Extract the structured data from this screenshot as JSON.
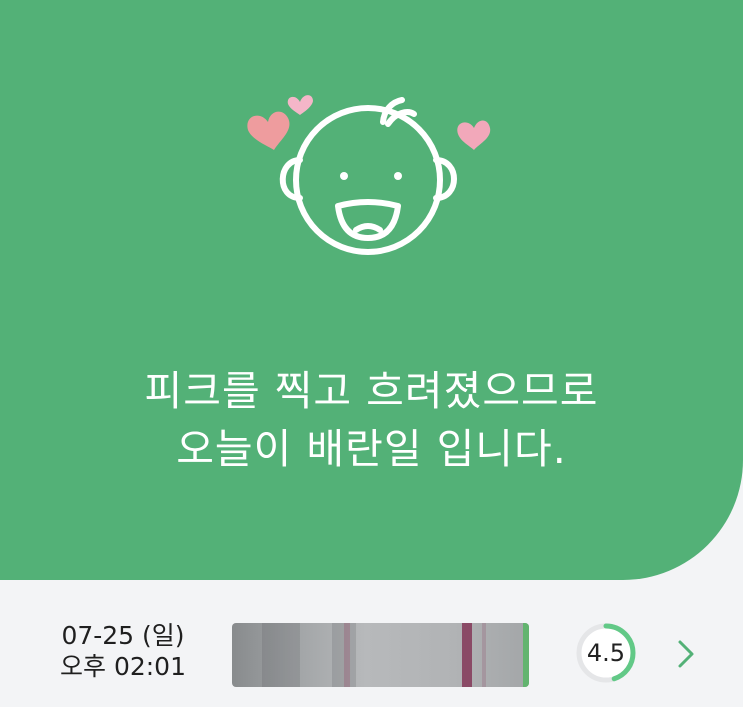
{
  "result": {
    "message_line1": "피크를 찍고 흐려졌으므로",
    "message_line2": "오늘이 배란일 입니다."
  },
  "record": {
    "date": "07-25 (일)",
    "time": "오후 02:01",
    "score": "4.5",
    "score_fraction": 0.45
  },
  "icons": {
    "illustration": "smiling-baby-face-icon",
    "hearts": "heart-icon",
    "next": "chevron-right-icon"
  },
  "colors": {
    "hero": "#53b177",
    "accent": "#62c987",
    "heart_pink": "#f2a8ba",
    "heart_coral": "#ee9c9e"
  }
}
